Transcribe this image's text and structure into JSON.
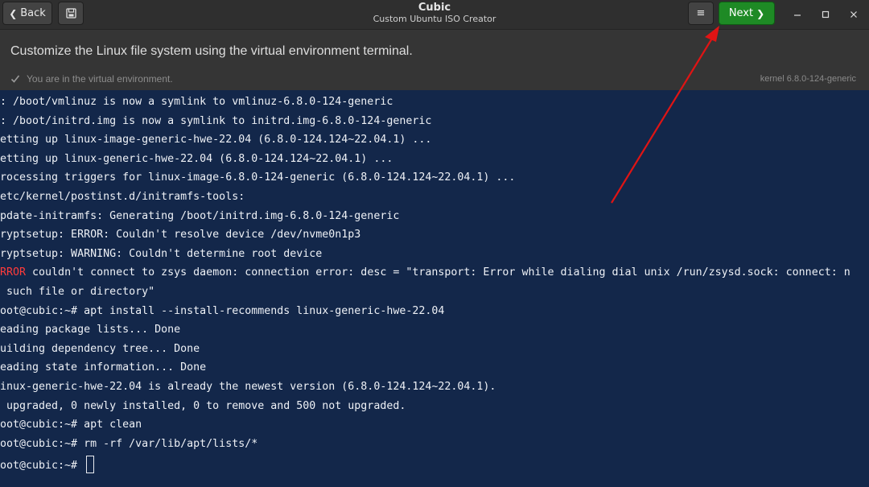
{
  "titlebar": {
    "back_label": "Back",
    "app_title": "Cubic",
    "app_subtitle": "Custom Ubuntu ISO Creator",
    "menu_icon": "≡",
    "next_label": "Next"
  },
  "header": {
    "heading": "Customize the Linux file system using the virtual environment terminal.",
    "status": "You are in the virtual environment.",
    "kernel": "kernel 6.8.0-124-generic"
  },
  "terminal": {
    "lines": [
      ": /boot/vmlinuz is now a symlink to vmlinuz-6.8.0-124-generic",
      ": /boot/initrd.img is now a symlink to initrd.img-6.8.0-124-generic",
      "etting up linux-image-generic-hwe-22.04 (6.8.0-124.124~22.04.1) ...",
      "etting up linux-generic-hwe-22.04 (6.8.0-124.124~22.04.1) ...",
      "rocessing triggers for linux-image-6.8.0-124-generic (6.8.0-124.124~22.04.1) ...",
      "etc/kernel/postinst.d/initramfs-tools:",
      "pdate-initramfs: Generating /boot/initrd.img-6.8.0-124-generic",
      "ryptsetup: ERROR: Couldn't resolve device /dev/nvme0n1p3",
      "ryptsetup: WARNING: Couldn't determine root device"
    ],
    "error_prefix": "RROR",
    "error_rest": " couldn't connect to zsys daemon: connection error: desc = \"transport: Error while dialing dial unix /run/zsysd.sock: connect: n",
    "lines2": [
      " such file or directory\"",
      "oot@cubic:~# apt install --install-recommends linux-generic-hwe-22.04",
      "eading package lists... Done",
      "uilding dependency tree... Done",
      "eading state information... Done",
      "inux-generic-hwe-22.04 is already the newest version (6.8.0-124.124~22.04.1).",
      " upgraded, 0 newly installed, 0 to remove and 500 not upgraded.",
      "oot@cubic:~# apt clean",
      "oot@cubic:~# rm -rf /var/lib/apt/lists/*"
    ],
    "prompt": "oot@cubic:~# "
  },
  "colors": {
    "terminal_bg": "#13274a",
    "next_button": "#1e8a25",
    "error_text": "#ff3b3b",
    "annotation_arrow": "#e01414"
  }
}
